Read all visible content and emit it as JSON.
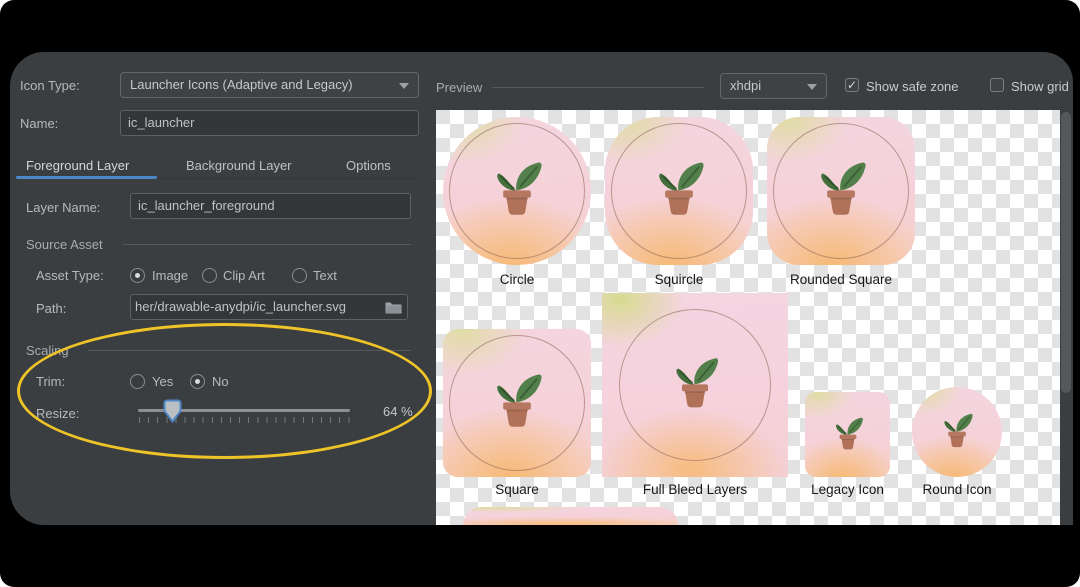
{
  "left_panel": {
    "icon_type": {
      "label": "Icon Type:",
      "value": "Launcher Icons (Adaptive and Legacy)"
    },
    "name": {
      "label": "Name:",
      "value": "ic_launcher"
    },
    "tabs": {
      "foreground": "Foreground Layer",
      "background": "Background Layer",
      "options": "Options",
      "active_tab": "Foreground Layer"
    },
    "layer_name": {
      "label": "Layer Name:",
      "value": "ic_launcher_foreground"
    },
    "source_asset": {
      "title": "Source Asset",
      "asset_type_label": "Asset Type:",
      "asset_types": {
        "image": "Image",
        "clip_art": "Clip Art",
        "text": "Text",
        "selected": "Image"
      },
      "path_label": "Path:",
      "path_value": "her/drawable-anydpi/ic_launcher.svg"
    },
    "scaling": {
      "title": "Scaling",
      "trim_label": "Trim:",
      "trim_options": {
        "yes": "Yes",
        "no": "No",
        "selected": "No"
      },
      "resize_label": "Resize:",
      "resize_value": "64 %",
      "resize_percent": 64
    }
  },
  "preview": {
    "title": "Preview",
    "density": "xhdpi",
    "show_safe_zone": "Show safe zone",
    "show_safe_zone_checked": true,
    "show_grid": "Show grid",
    "show_grid_checked": false,
    "check_glyph": "✓",
    "icons": {
      "circle": "Circle",
      "squircle": "Squircle",
      "rounded_square": "Rounded Square",
      "square": "Square",
      "full_bleed": "Full Bleed Layers",
      "legacy": "Legacy Icon",
      "round": "Round Icon"
    }
  },
  "annotation": {
    "shape": "ellipse",
    "color": "#efc428",
    "highlights": "Scaling section"
  },
  "colors": {
    "panel_bg": "#3b3e40",
    "tab_accent": "#4a88c7",
    "slider_thumb_border": "#4f88c4",
    "icon_bg_pink": "#f4d5df",
    "icon_bg_orange": "#f7bd82",
    "leaf_light": "#53804a",
    "leaf_dark": "#446e3c",
    "pot": "#b3745b"
  }
}
